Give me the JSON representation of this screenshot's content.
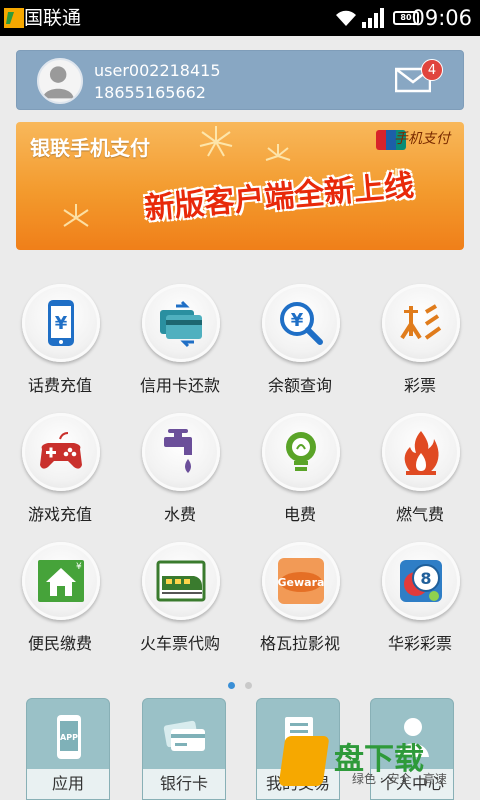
{
  "status_bar": {
    "carrier": "国联通",
    "battery": "80",
    "time": "09:06"
  },
  "user": {
    "name": "user002218415",
    "phone": "18655165662",
    "unread_messages": "4"
  },
  "banner": {
    "title": "银联手机支付",
    "brand": "手机支付",
    "slogan": "新版客户端全新上线"
  },
  "services": [
    {
      "label": "话费充值",
      "icon": "phone-yuan-icon"
    },
    {
      "label": "信用卡还款",
      "icon": "credit-card-icon"
    },
    {
      "label": "余额查询",
      "icon": "magnifier-yuan-icon"
    },
    {
      "label": "彩票",
      "icon": "lottery-character-icon"
    },
    {
      "label": "游戏充值",
      "icon": "gamepad-icon"
    },
    {
      "label": "水费",
      "icon": "faucet-icon"
    },
    {
      "label": "电费",
      "icon": "lightbulb-icon"
    },
    {
      "label": "燃气费",
      "icon": "flame-icon"
    },
    {
      "label": "便民缴费",
      "icon": "house-yuan-icon"
    },
    {
      "label": "火车票代购",
      "icon": "train-icon"
    },
    {
      "label": "格瓦拉影视",
      "icon": "gewara-icon"
    },
    {
      "label": "华彩彩票",
      "icon": "lottery-ball-icon"
    }
  ],
  "gewara_text": "Gewara",
  "page_indicator": {
    "pages": 2,
    "active": 1
  },
  "bottom_tabs": [
    {
      "label": "应用",
      "icon": "app-phone-icon"
    },
    {
      "label": "银行卡",
      "icon": "bank-card-icon"
    },
    {
      "label": "我的交易",
      "icon": "transaction-list-icon"
    },
    {
      "label": "个人中心",
      "icon": "person-icon"
    }
  ],
  "app_icon_text": "APP",
  "watermark": {
    "main": "盘下载",
    "sub": "绿色 · 安全 · 高速"
  },
  "colors": {
    "user_card": "#88a7c3",
    "banner": "#f39a2d",
    "tab": "#9ac1c7",
    "badge": "#e0443e"
  }
}
